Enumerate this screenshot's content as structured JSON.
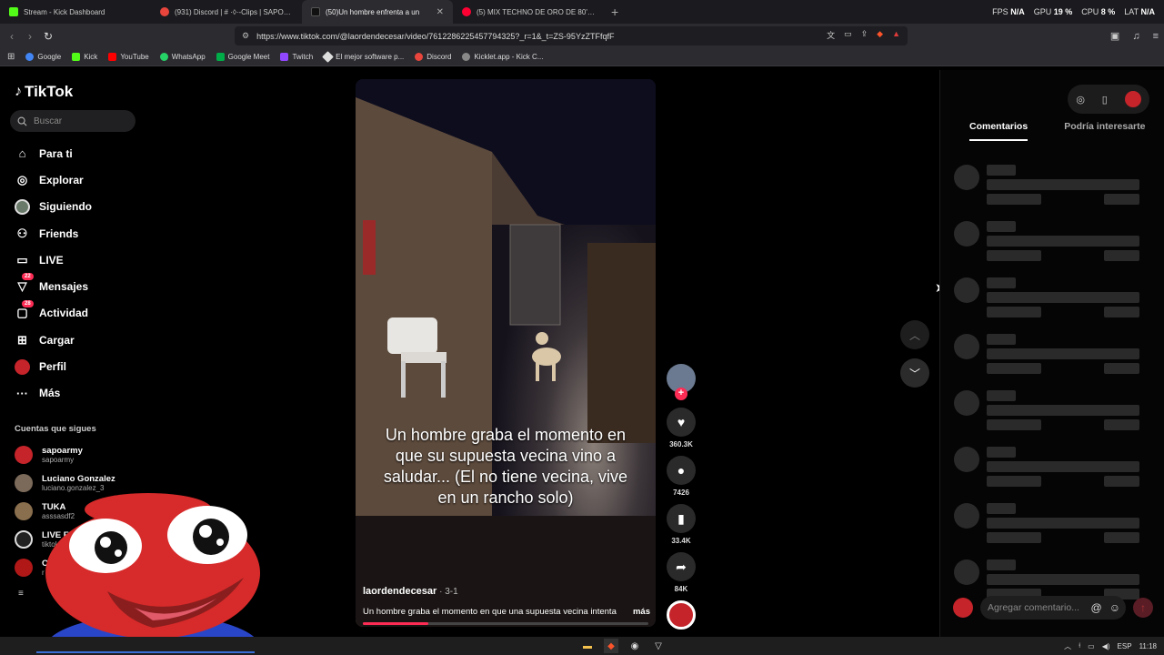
{
  "browser": {
    "tabs": [
      {
        "title": "Stream - Kick Dashboard",
        "color": "#53fc18",
        "active": false
      },
      {
        "title": "(931) Discord | # ·◊·-Clips | SAPOLIOS",
        "color": "#e8453c",
        "active": false
      },
      {
        "title": "(50)Un hombre enfrenta a un",
        "color": "#111111",
        "active": true
      },
      {
        "title": "(5) MIX TECHNO DE ORO DE 80's &",
        "color": "#ff0033",
        "active": false
      }
    ],
    "new_tab": "+",
    "perf": {
      "fps_label": "FPS",
      "fps": "N/A",
      "gpu_label": "GPU",
      "gpu": "19 %",
      "cpu_label": "CPU",
      "cpu": "8 %",
      "lat_label": "LAT",
      "lat": "N/A"
    },
    "url": "https://www.tiktok.com/@laordendecesar/video/7612286225457794325?_r=1&_t=ZS-95YzZTFfqfF",
    "bookmarks": [
      {
        "label": "Google",
        "color": "#4285f4"
      },
      {
        "label": "Kick",
        "color": "#53fc18"
      },
      {
        "label": "YouTube",
        "color": "#ff0000"
      },
      {
        "label": "WhatsApp",
        "color": "#25d366"
      },
      {
        "label": "Google Meet",
        "color": "#00ac47"
      },
      {
        "label": "Twitch",
        "color": "#9146ff"
      },
      {
        "label": "El mejor software p...",
        "color": "#dddddd"
      },
      {
        "label": "Discord",
        "color": "#e8453c"
      },
      {
        "label": "Kicklet.app - Kick C...",
        "color": "#888888"
      }
    ]
  },
  "tiktok": {
    "brand": "TikTok",
    "search_placeholder": "Buscar",
    "menu": [
      {
        "label": "Para ti",
        "icon": "home-icon",
        "badge": ""
      },
      {
        "label": "Explorar",
        "icon": "compass-icon",
        "badge": ""
      },
      {
        "label": "Siguiendo",
        "icon": "following-avatar-icon",
        "badge": ""
      },
      {
        "label": "Friends",
        "icon": "friends-icon",
        "badge": ""
      },
      {
        "label": "LIVE",
        "icon": "live-icon",
        "badge": ""
      },
      {
        "label": "Mensajes",
        "icon": "messages-icon",
        "badge": "22"
      },
      {
        "label": "Actividad",
        "icon": "activity-icon",
        "badge": "28"
      },
      {
        "label": "Cargar",
        "icon": "upload-icon",
        "badge": ""
      },
      {
        "label": "Perfil",
        "icon": "profile-icon",
        "badge": ""
      },
      {
        "label": "Más",
        "icon": "more-icon",
        "badge": ""
      }
    ],
    "following_header": "Cuentas que sigues",
    "accounts": [
      {
        "name": "sapoarmy",
        "user": "sapoarmy"
      },
      {
        "name": "Luciano Gonzalez",
        "user": "luciano.gonzalez_3"
      },
      {
        "name": "TUKA",
        "user": "asssasdf2"
      },
      {
        "name": "LIVE Fe",
        "user": "tiktok"
      },
      {
        "name": "C",
        "user": "r"
      }
    ],
    "video": {
      "caption": "Un hombre graba el momento en que su supuesta vecina vino a saludar... (El no tiene vecina, vive en un rancho solo)",
      "author": "laordendecesar",
      "date": " · 3-1",
      "description": "Un hombre graba el momento en que una supuesta vecina intenta",
      "more": "más",
      "progress": 0.23
    },
    "actions": {
      "likes": "360.3K",
      "comments": "7426",
      "saves": "33.4K",
      "shares": "84K"
    },
    "right_panel": {
      "tab_comments": "Comentarios",
      "tab_other": "Podría interesarte",
      "comment_placeholder": "Agregar comentario...",
      "at_icon": "@"
    }
  },
  "taskbar": {
    "lang": "ESP",
    "time": "11:18"
  }
}
